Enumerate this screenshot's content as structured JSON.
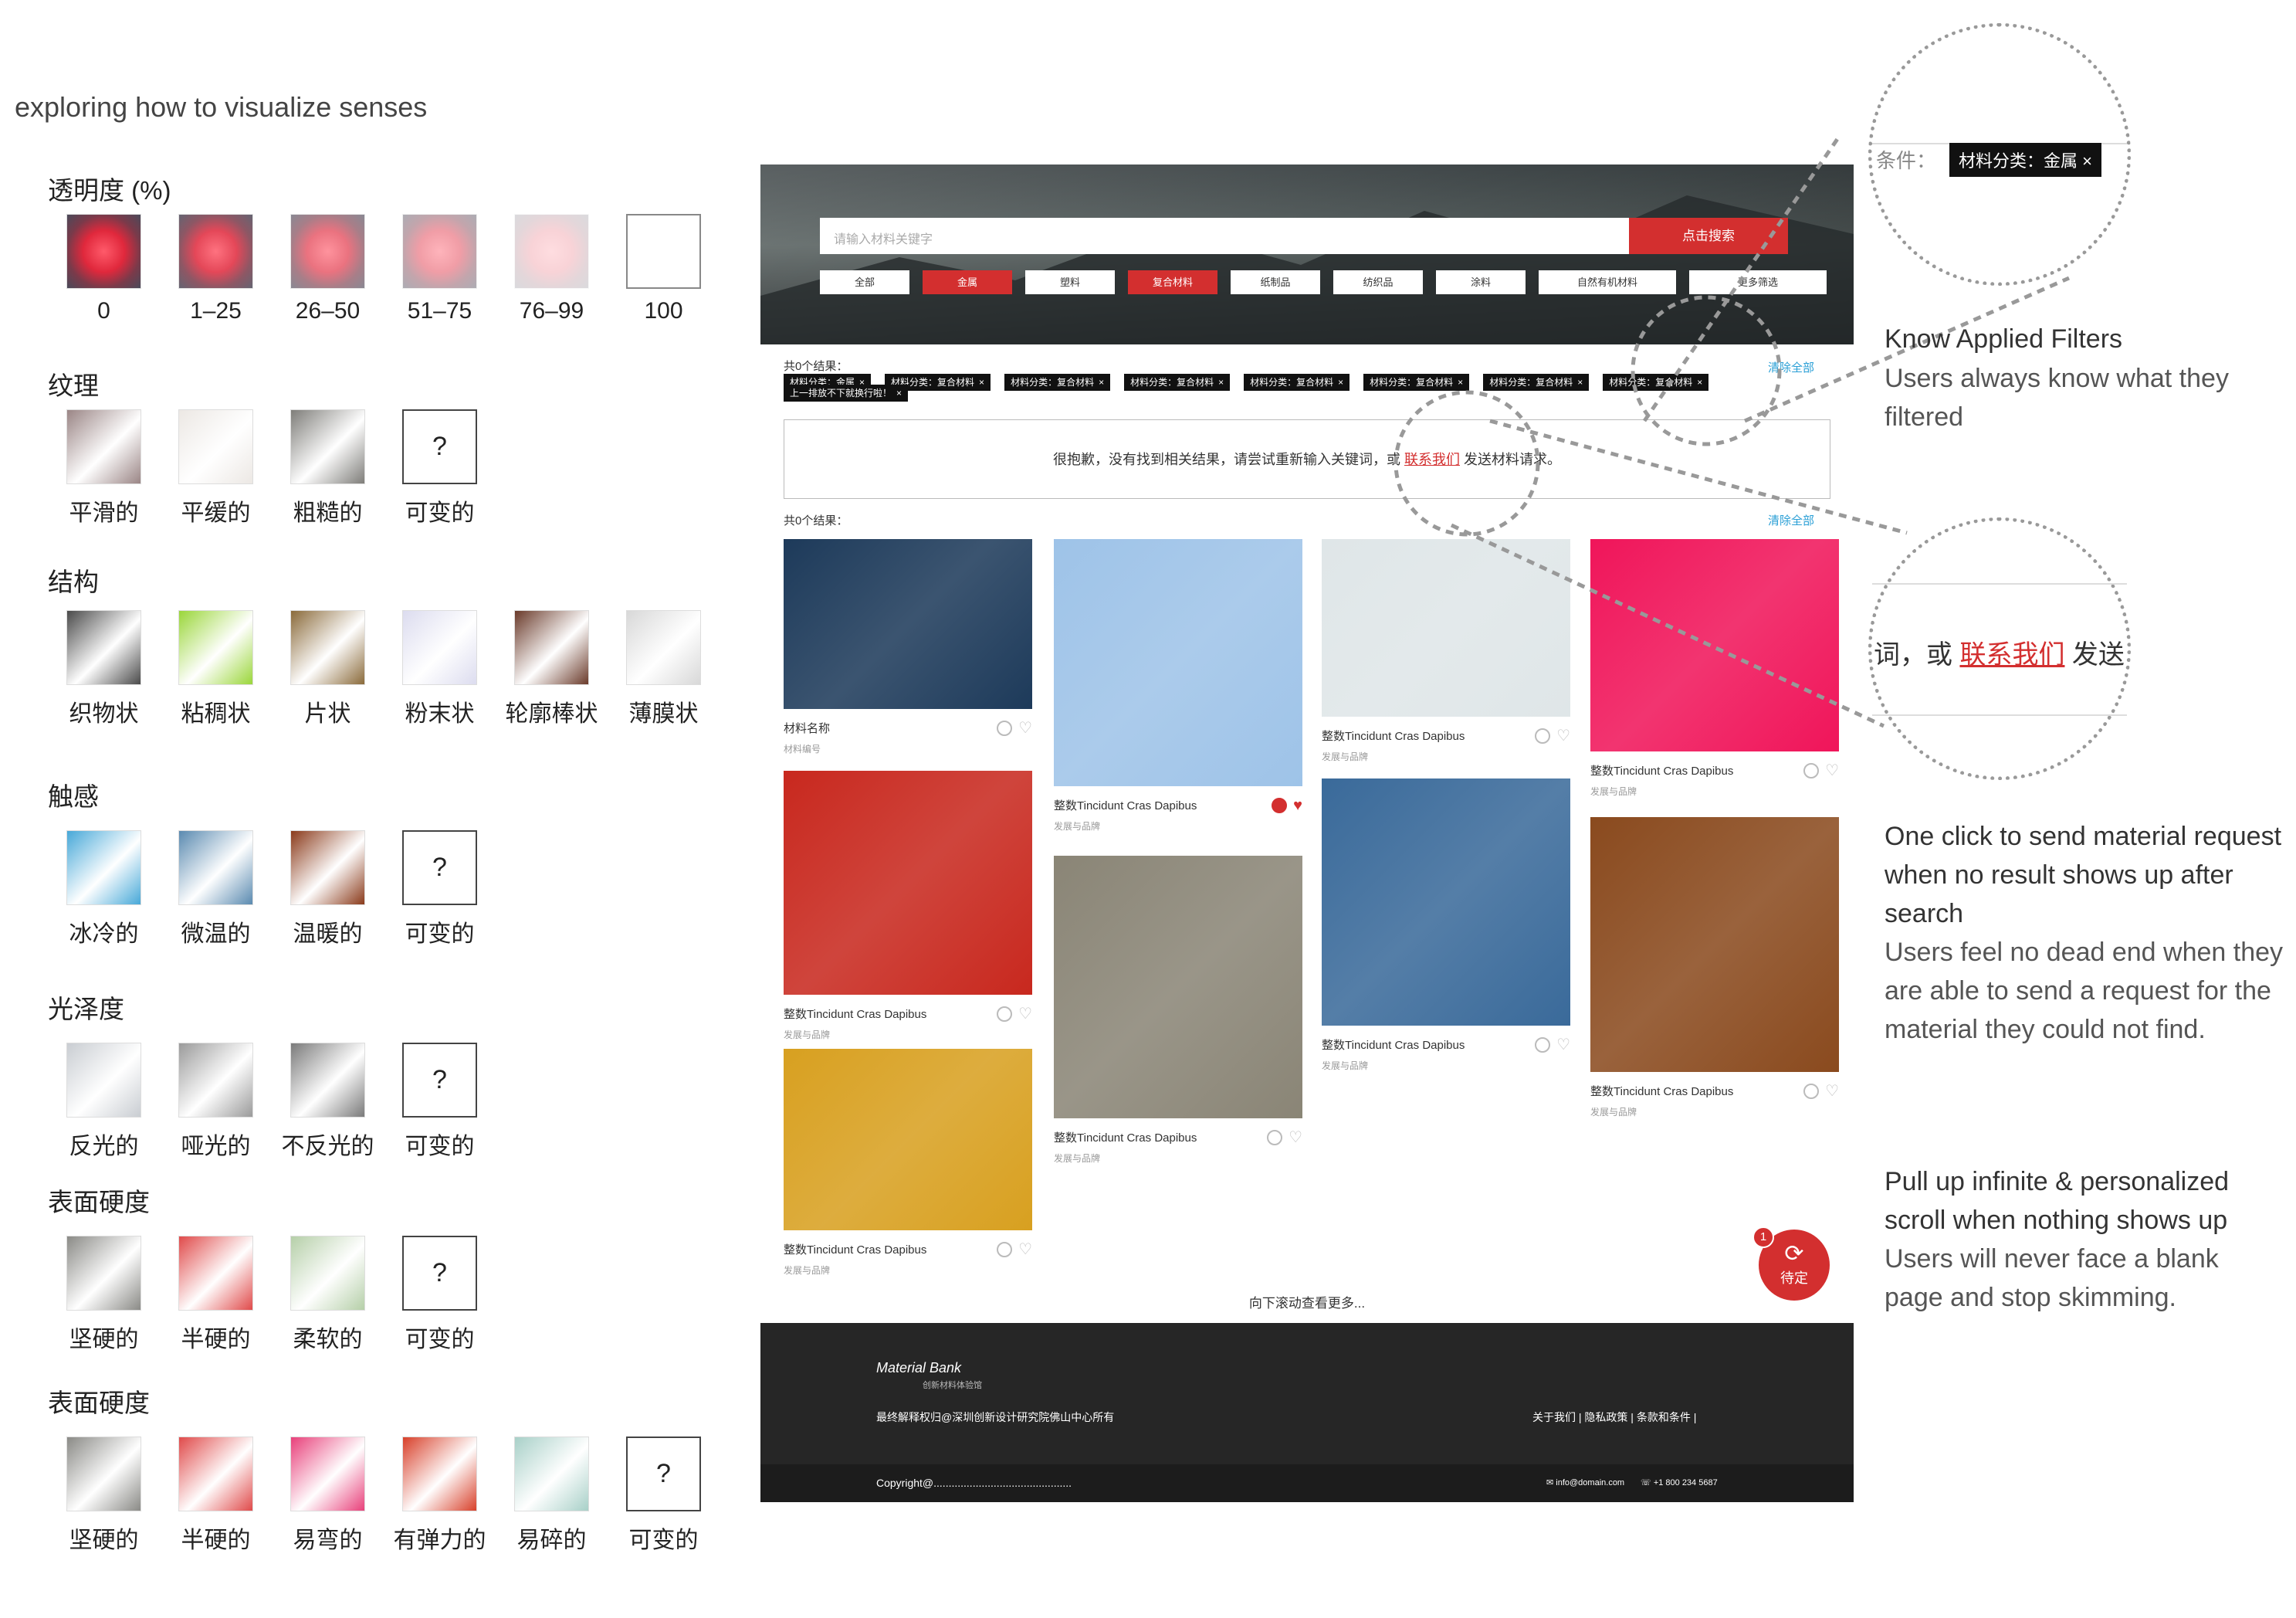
{
  "heading": "exploring how to visualize senses",
  "sections": [
    {
      "title": "透明度 (%)",
      "items": [
        {
          "label": "0",
          "icon": "flower-photo",
          "type": "img",
          "opacity": 1.0
        },
        {
          "label": "1–25",
          "icon": "flower-photo",
          "type": "img",
          "opacity": 0.85
        },
        {
          "label": "26–50",
          "icon": "flower-photo",
          "type": "img",
          "opacity": 0.65
        },
        {
          "label": "51–75",
          "icon": "flower-photo",
          "type": "img",
          "opacity": 0.45
        },
        {
          "label": "76–99",
          "icon": "flower-photo",
          "type": "img",
          "opacity": 0.2
        },
        {
          "label": "100",
          "icon": "empty-box",
          "type": "empty",
          "opacity": 0
        }
      ]
    },
    {
      "title": "纹理",
      "items": [
        {
          "label": "平滑的",
          "icon": "smooth-texture",
          "type": "img",
          "color": "#9a8585"
        },
        {
          "label": "平缓的",
          "icon": "sand-texture",
          "type": "img",
          "color": "#ece8e4"
        },
        {
          "label": "粗糙的",
          "icon": "rough-texture",
          "type": "img",
          "color": "#7e7d79"
        },
        {
          "label": "可变的",
          "icon": "question-mark",
          "type": "q",
          "mark": "?"
        }
      ]
    },
    {
      "title": "结构",
      "items": [
        {
          "label": "织物状",
          "icon": "woven-texture",
          "type": "img",
          "color": "#4a4a4a"
        },
        {
          "label": "粘稠状",
          "icon": "slime-texture",
          "type": "img",
          "color": "#9ad63a"
        },
        {
          "label": "片状",
          "icon": "flake-texture",
          "type": "img",
          "color": "#8a6a3a"
        },
        {
          "label": "粉末状",
          "icon": "powder-texture",
          "type": "img",
          "color": "#dcdcef"
        },
        {
          "label": "轮廓棒状",
          "icon": "rod-texture",
          "type": "img",
          "color": "#6a3a2a"
        },
        {
          "label": "薄膜状",
          "icon": "film-texture",
          "type": "img",
          "color": "#d8d8d8"
        }
      ]
    },
    {
      "title": "触感",
      "items": [
        {
          "label": "冰冷的",
          "icon": "ice-photo",
          "type": "img",
          "color": "#47a8d8"
        },
        {
          "label": "微温的",
          "icon": "sea-photo",
          "type": "img",
          "color": "#5a8ab0"
        },
        {
          "label": "温暖的",
          "icon": "tea-photo",
          "type": "img",
          "color": "#8a3a1a"
        },
        {
          "label": "可变的",
          "icon": "question-mark",
          "type": "q",
          "mark": "?"
        }
      ]
    },
    {
      "title": "光泽度",
      "items": [
        {
          "label": "反光的",
          "icon": "glossy-texture",
          "type": "img",
          "color": "#c9cdd2"
        },
        {
          "label": "哑光的",
          "icon": "matte-texture",
          "type": "img",
          "color": "#9a9a9a"
        },
        {
          "label": "不反光的",
          "icon": "dull-texture",
          "type": "img",
          "color": "#7a7a7a"
        },
        {
          "label": "可变的",
          "icon": "question-mark",
          "type": "q",
          "mark": "?"
        }
      ]
    },
    {
      "title": "表面硬度",
      "items": [
        {
          "label": "坚硬的",
          "icon": "stone-photo",
          "type": "img",
          "color": "#8a8a86"
        },
        {
          "label": "半硬的",
          "icon": "eraser-photo",
          "type": "img",
          "color": "#e04a4a"
        },
        {
          "label": "柔软的",
          "icon": "cloth-photo",
          "type": "img",
          "color": "#b5cfa8"
        },
        {
          "label": "可变的",
          "icon": "question-mark",
          "type": "q",
          "mark": "?"
        }
      ]
    },
    {
      "title": "表面硬度",
      "items": [
        {
          "label": "坚硬的",
          "icon": "stone-photo",
          "type": "img",
          "color": "#8a8a86"
        },
        {
          "label": "半硬的",
          "icon": "eraser-photo",
          "type": "img",
          "color": "#e04a4a"
        },
        {
          "label": "易弯的",
          "icon": "straws-photo",
          "type": "img",
          "color": "#e8407a"
        },
        {
          "label": "有弹力的",
          "icon": "balloons-photo",
          "type": "img",
          "color": "#d8402a"
        },
        {
          "label": "易碎的",
          "icon": "glass-photo",
          "type": "img",
          "color": "#a8d0c8"
        },
        {
          "label": "可变的",
          "icon": "question-mark",
          "type": "q",
          "mark": "?"
        }
      ]
    }
  ],
  "site": {
    "search_placeholder": "请输入材料关键字",
    "search_button": "点击搜索",
    "chips": [
      {
        "label": "全部",
        "active": false
      },
      {
        "label": "金属",
        "active": true
      },
      {
        "label": "塑料",
        "active": false
      },
      {
        "label": "复合材料",
        "active": true
      },
      {
        "label": "纸制品",
        "active": false
      },
      {
        "label": "纺织品",
        "active": false
      },
      {
        "label": "涂料",
        "active": false
      },
      {
        "label": "自然有机材料",
        "active": false
      },
      {
        "label": "更多筛选",
        "active": false
      }
    ],
    "result_count_top": "共0个结果：",
    "filter_tags": [
      "材料分类：金属",
      "材料分类：复合材料",
      "材料分类：复合材料",
      "材料分类：复合材料",
      "材料分类：复合材料",
      "材料分类：复合材料",
      "材料分类：复合材料",
      "材料分类：复合材料"
    ],
    "filter_tag_extra": "上一排放不下就换行啦！",
    "clear_all": "清除全部",
    "no_result_before": "很抱歉，没有找到相关结果，请尝试重新输入关键词，或 ",
    "no_result_link": "联系我们",
    "no_result_after": " 发送材料请求。",
    "result_count_bottom": "共0个结果：",
    "clear_all_2": "清除全部",
    "cards": [
      {
        "title": "材料名称",
        "sub": "材料编号",
        "img": "denim",
        "color": "#1d3a5a",
        "liked": false
      },
      {
        "title": "整数Tincidunt Cras Dapibus",
        "sub": "发展与品牌",
        "img": "red-blue-fabric",
        "color": "#c8281e",
        "liked": false
      },
      {
        "title": "整数Tincidunt Cras Dapibus",
        "sub": "发展与品牌",
        "img": "amber-resin",
        "color": "#d8a020",
        "liked": false
      },
      {
        "title": "整数Tincidunt Cras Dapibus",
        "sub": "发展与品牌",
        "img": "shirt-fabric",
        "color": "#9ec3e8",
        "liked": true
      },
      {
        "title": "整数Tincidunt Cras Dapibus",
        "sub": "发展与品牌",
        "img": "terrazzo-disc",
        "color": "#8a8576",
        "liked": false
      },
      {
        "title": "整数Tincidunt Cras Dapibus",
        "sub": "发展与品牌",
        "img": "salt-jar",
        "color": "#dfe6e8",
        "liked": false
      },
      {
        "title": "整数Tincidunt Cras Dapibus",
        "sub": "发展与品牌",
        "img": "blue-gel",
        "color": "#3a6a9a",
        "liked": false
      },
      {
        "title": "整数Tincidunt Cras Dapibus",
        "sub": "发展与品牌",
        "img": "pink-fabric",
        "color": "#f0155a",
        "liked": false
      },
      {
        "title": "整数Tincidunt Cras Dapibus",
        "sub": "发展与品牌",
        "img": "bronze-ball",
        "color": "#8a4a1e",
        "liked": false
      }
    ],
    "scroll_more": "向下滚动查看更多...",
    "badge_count": "1",
    "badge_label": "待定",
    "footer_logo": "Material Bank",
    "footer_logo_sub": "创新材料体验馆",
    "footer_rights": "最终解释权归@深圳创新设计研究院佛山中心所有",
    "footer_links": "关于我们 | 隐私政策 | 条款和条件 |",
    "footer_copyright": "Copyright@..............................................",
    "footer_email": "info@domain.com",
    "footer_phone": "+1 800 234 5687"
  },
  "annotations": {
    "zoom1_label": "条件：",
    "zoom1_tag": "材料分类：金属",
    "zoom2_text_before": "词，或 ",
    "zoom2_link": "联系我们",
    "zoom2_text_after": " 发送",
    "a1_title": "Know Applied Filters",
    "a1_body": "Users always know what they filtered",
    "a2_title": "One click to send material request when no result shows up after search",
    "a2_body": "Users feel no dead end when they are able to send a request for the material they could not find.",
    "a3_title": "Pull up infinite & personalized scroll when nothing shows up",
    "a3_body": "Users will never face a blank page and stop skimming."
  }
}
